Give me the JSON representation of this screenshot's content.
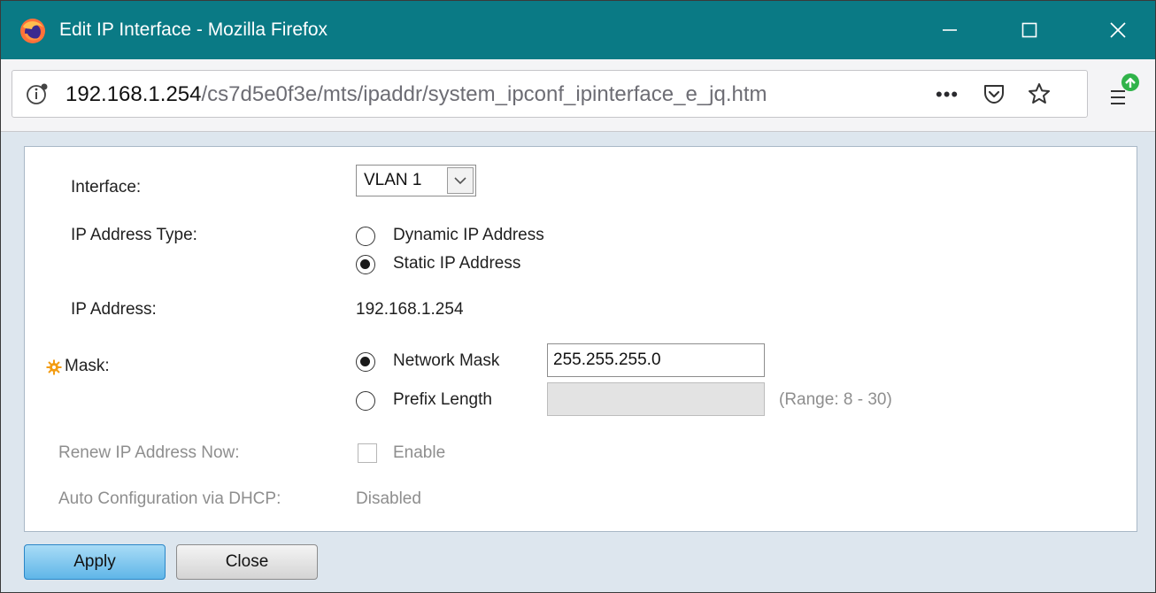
{
  "window": {
    "title": "Edit IP Interface - Mozilla Firefox",
    "minimize_label": "Minimize",
    "maximize_label": "Maximize",
    "close_label": "Close"
  },
  "address_bar": {
    "url_host": "192.168.1.254",
    "url_path": "/cs7d5e0f3e/mts/ipaddr/system_ipconf_ipinterface_e_jq.htm",
    "more_icon_text": "•••"
  },
  "form": {
    "interface": {
      "label": "Interface:",
      "selected": "VLAN 1"
    },
    "ip_address_type": {
      "label": "IP Address Type:",
      "options": [
        {
          "label": "Dynamic IP Address",
          "checked": false
        },
        {
          "label": "Static IP Address",
          "checked": true
        }
      ]
    },
    "ip_address": {
      "label": "IP Address:",
      "value": "192.168.1.254"
    },
    "mask": {
      "label": "Mask:",
      "network_mask_label": "Network Mask",
      "network_mask_value": "255.255.255.0",
      "network_mask_checked": true,
      "prefix_length_label": "Prefix Length",
      "prefix_length_value": "",
      "prefix_length_checked": false,
      "range_hint": "(Range: 8 - 30)"
    },
    "renew": {
      "label": "Renew IP Address Now:",
      "checkbox_label": "Enable",
      "checked": false,
      "disabled": true
    },
    "auto_config": {
      "label": "Auto Configuration via DHCP:",
      "value": "Disabled"
    }
  },
  "buttons": {
    "apply": "Apply",
    "close": "Close"
  },
  "colors": {
    "titlebar": "#0a7a85",
    "content_bg": "#dde6ee",
    "required_icon": "#f39c12",
    "apply_button": "#5fb6e8"
  }
}
